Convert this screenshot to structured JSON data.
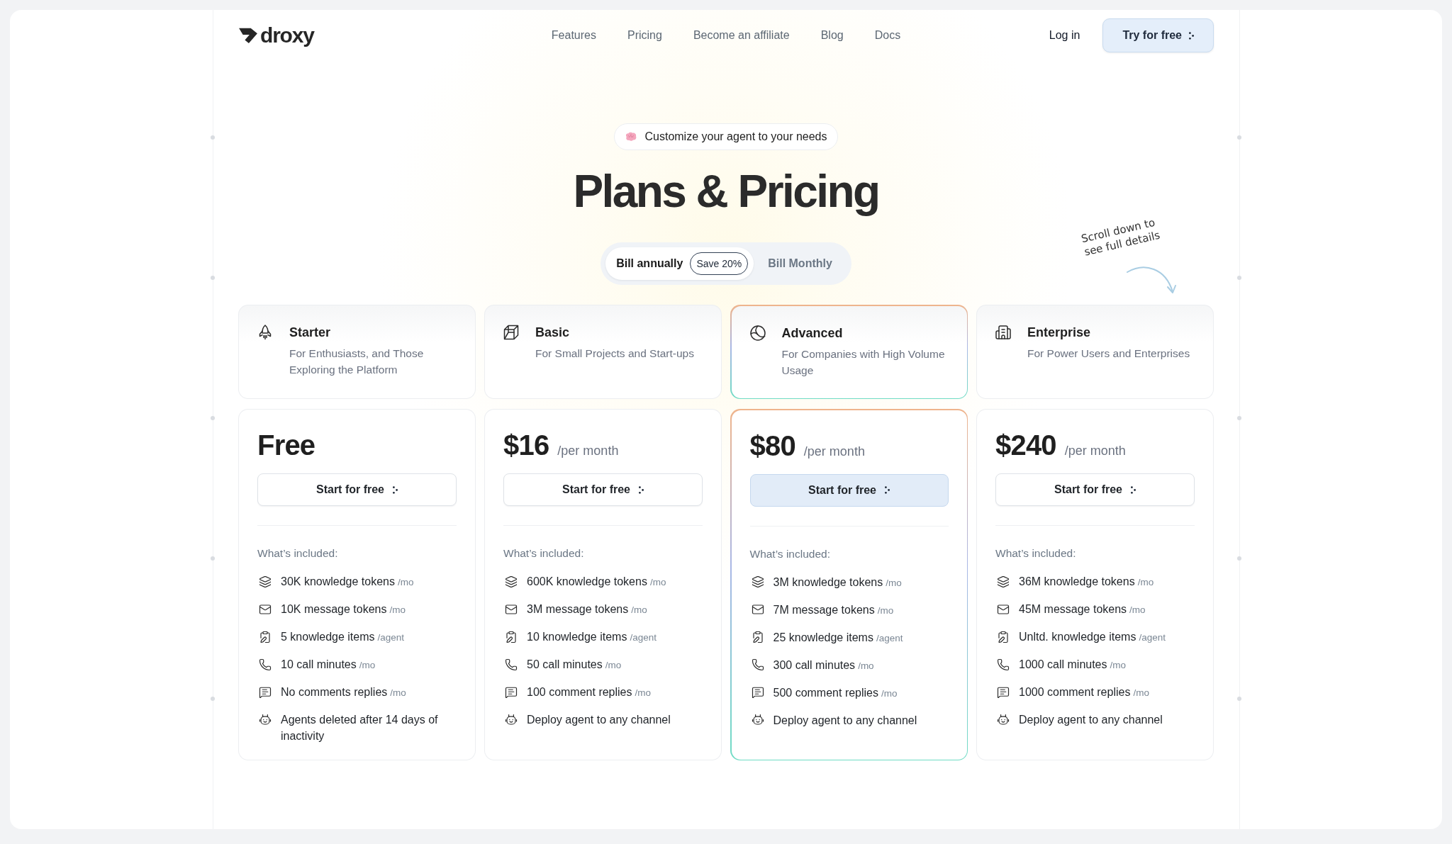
{
  "nav": {
    "logo": "droxy",
    "links": [
      {
        "label": "Features"
      },
      {
        "label": "Pricing"
      },
      {
        "label": "Become an affiliate"
      },
      {
        "label": "Blog"
      },
      {
        "label": "Docs"
      }
    ],
    "login": "Log in",
    "cta": "Try for free"
  },
  "hero": {
    "badge": "Customize your agent to your needs",
    "title": "Plans & Pricing",
    "scroll_note": "Scroll down to see full details"
  },
  "billing_toggle": [
    {
      "label": "Bill annually",
      "selected": true,
      "tag": "Save 20%"
    },
    {
      "label": "Bill Monthly",
      "selected": false
    }
  ],
  "plans": [
    {
      "name": "Starter",
      "tagline": "For Enthusiasts, and Those Exploring the Platform",
      "featured": false,
      "price": "Free",
      "button": "Start for free",
      "included_label": "What’s included:",
      "features": [
        {
          "text": "30K knowledge tokens",
          "unit": "/mo"
        },
        {
          "text": "10K message tokens",
          "unit": "/mo"
        },
        {
          "text": "5 knowledge items",
          "unit": "/agent"
        },
        {
          "text": "10 call minutes",
          "unit": "/mo"
        },
        {
          "text": "No comments replies",
          "unit": "/mo"
        },
        {
          "text": "Agents deleted after 14 days of inactivity"
        }
      ]
    },
    {
      "name": "Basic",
      "tagline": "For Small Projects and Start-ups",
      "featured": false,
      "price": "$16",
      "period": "/per month",
      "button": "Start for free",
      "included_label": "What’s included:",
      "features": [
        {
          "text": "600K knowledge tokens",
          "unit": "/mo"
        },
        {
          "text": "3M message tokens",
          "unit": "/mo"
        },
        {
          "text": "10 knowledge items",
          "unit": "/agent"
        },
        {
          "text": "50 call minutes",
          "unit": "/mo"
        },
        {
          "text": "100 comment replies",
          "unit": "/mo"
        },
        {
          "text": "Deploy agent to any channel"
        }
      ]
    },
    {
      "name": "Advanced",
      "tagline": "For Companies with High Volume Usage",
      "featured": true,
      "price": "$80",
      "period": "/per month",
      "button": "Start for free",
      "included_label": "What’s included:",
      "features": [
        {
          "text": "3M knowledge tokens",
          "unit": "/mo"
        },
        {
          "text": "7M message tokens",
          "unit": "/mo"
        },
        {
          "text": "25 knowledge items",
          "unit": "/agent"
        },
        {
          "text": "300 call minutes",
          "unit": "/mo"
        },
        {
          "text": "500 comment replies",
          "unit": "/mo"
        },
        {
          "text": "Deploy agent to any channel"
        }
      ]
    },
    {
      "name": "Enterprise",
      "tagline": "For Power Users and Enterprises",
      "featured": false,
      "price": "$240",
      "period": "/per month",
      "button": "Start for free",
      "included_label": "What’s included:",
      "features": [
        {
          "text": "36M knowledge tokens",
          "unit": "/mo"
        },
        {
          "text": "45M message tokens",
          "unit": "/mo"
        },
        {
          "text": "Unltd. knowledge items",
          "unit": "/agent"
        },
        {
          "text": "1000 call minutes",
          "unit": "/mo"
        },
        {
          "text": "1000 comment replies",
          "unit": "/mo"
        },
        {
          "text": "Deploy agent to any channel"
        }
      ]
    }
  ]
}
